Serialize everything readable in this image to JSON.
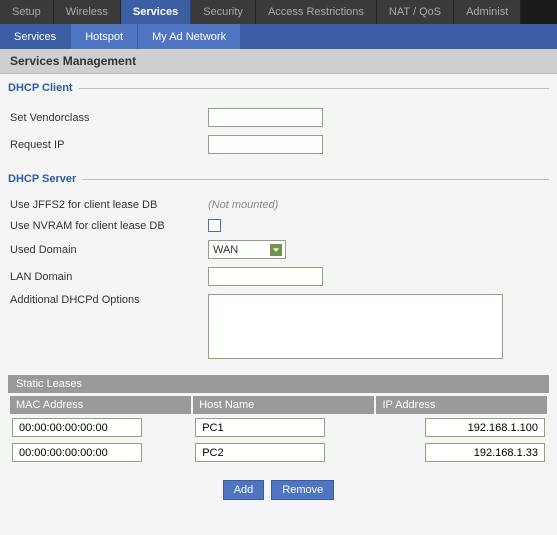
{
  "main_tabs": [
    "Setup",
    "Wireless",
    "Services",
    "Security",
    "Access Restrictions",
    "NAT / QoS",
    "Administ"
  ],
  "main_active_index": 2,
  "sub_tabs": [
    "Services",
    "Hotspot",
    "My Ad Network"
  ],
  "sub_active_index": 0,
  "page_title": "Services Management",
  "dhcp_client": {
    "legend": "DHCP Client",
    "vendorclass_label": "Set Vendorclass",
    "vendorclass_value": "",
    "requestip_label": "Request IP",
    "requestip_value": ""
  },
  "dhcp_server": {
    "legend": "DHCP Server",
    "jffs2_label": "Use JFFS2 for client lease DB",
    "jffs2_hint": "(Not mounted)",
    "nvram_label": "Use NVRAM for client lease DB",
    "nvram_checked": false,
    "used_domain_label": "Used Domain",
    "used_domain_value": "WAN",
    "lan_domain_label": "LAN Domain",
    "lan_domain_value": "",
    "dhcpd_options_label": "Additional DHCPd Options",
    "dhcpd_options_value": ""
  },
  "leases": {
    "title": "Static Leases",
    "headers": [
      "MAC Address",
      "Host Name",
      "IP Address"
    ],
    "rows": [
      {
        "mac": "00:00:00:00:00:00",
        "host": "PC1",
        "ip": "192.168.1.100"
      },
      {
        "mac": "00:00:00:00:00:00",
        "host": "PC2",
        "ip": "192.168.1.33"
      }
    ],
    "add_label": "Add",
    "remove_label": "Remove"
  }
}
